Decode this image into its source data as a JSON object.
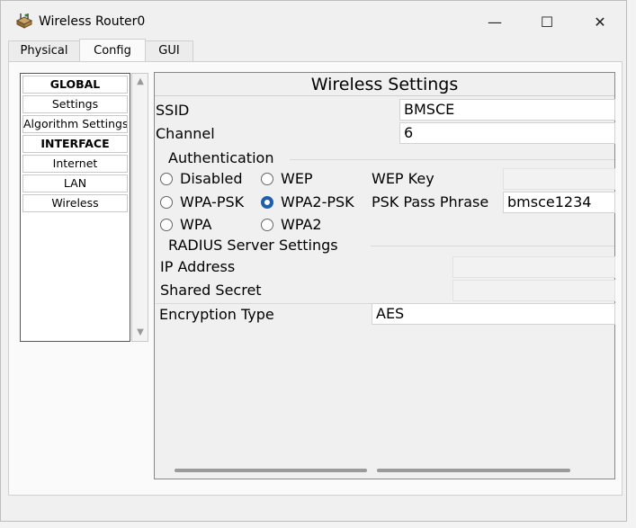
{
  "window": {
    "title": "Wireless Router0",
    "minimize": "—",
    "maximize": "☐",
    "close": "✕"
  },
  "tabs": [
    "Physical",
    "Config",
    "GUI"
  ],
  "nav": {
    "items": [
      "GLOBAL",
      "Settings",
      "Algorithm Settings",
      "INTERFACE",
      "Internet",
      "LAN",
      "Wireless"
    ],
    "scroll_up": "▲",
    "scroll_down": "▼"
  },
  "wireless": {
    "title": "Wireless Settings",
    "ssid_label": "SSID",
    "ssid_value": "BMSCE",
    "channel_label": "Channel",
    "channel_value": "6",
    "auth_label": "Authentication",
    "auth_options": {
      "disabled": "Disabled",
      "wep": "WEP",
      "wpa_psk": "WPA-PSK",
      "wpa2_psk": "WPA2-PSK",
      "wpa": "WPA",
      "wpa2": "WPA2"
    },
    "auth_selected": "WPA2-PSK",
    "wep_key_label": "WEP Key",
    "wep_key_value": "",
    "psk_label": "PSK Pass Phrase",
    "psk_value": "bmsce1234",
    "radius_label": "RADIUS Server Settings",
    "ip_label": "IP Address",
    "ip_value": "",
    "secret_label": "Shared Secret",
    "secret_value": "",
    "encryption_label": "Encryption Type",
    "encryption_value": "AES"
  },
  "colors": {
    "radio_selected": "#1f5fae"
  }
}
